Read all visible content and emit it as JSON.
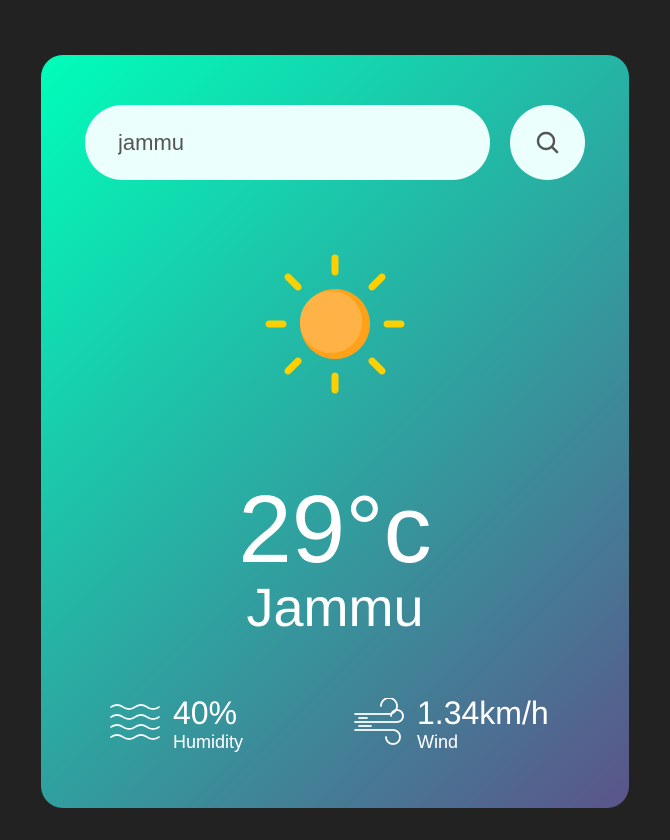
{
  "search": {
    "value": "jammu",
    "icon": "search-icon"
  },
  "weather": {
    "icon": "sun-icon",
    "temperature": "29°c",
    "city": "Jammu"
  },
  "details": {
    "humidity": {
      "icon": "humidity-icon",
      "value": "40%",
      "label": "Humidity"
    },
    "wind": {
      "icon": "wind-icon",
      "value": "1.34km/h",
      "label": "Wind"
    }
  },
  "colors": {
    "background": "#222222",
    "gradient_start": "#00feba",
    "gradient_end": "#5b548a",
    "input_bg": "#ebfffc",
    "sun_core": "#ffb13d",
    "sun_rays": "#ffd000"
  }
}
